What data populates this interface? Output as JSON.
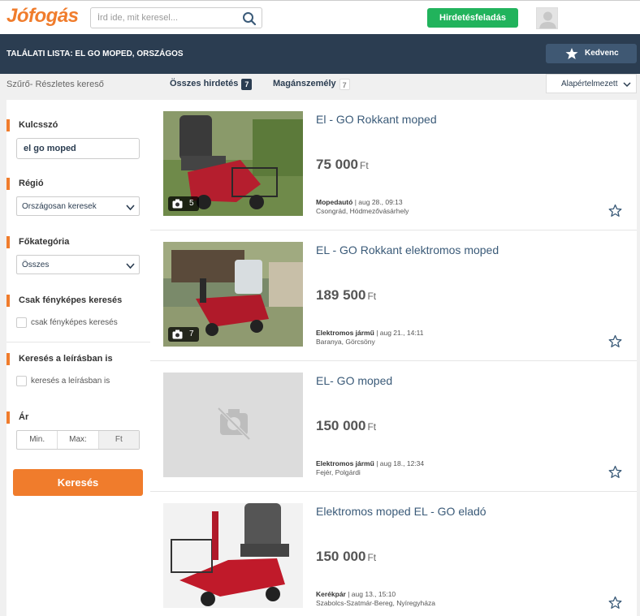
{
  "header": {
    "logo": "Jófogás",
    "search_placeholder": "Írd ide, mit keresel...",
    "post_button": "Hirdetésfeladás"
  },
  "bar": {
    "results_title": "TALÁLATI LISTA: EL GO MOPED, ORSZÁGOS",
    "favorite_button": "Kedvenc"
  },
  "tabs": {
    "filter_link": "Szűrő- Részletes kereső",
    "all_label": "Összes hirdetés",
    "all_count": "7",
    "private_label": "Magánszemély",
    "private_count": "7",
    "sort_value": "Alapértelmezett"
  },
  "sidebar": {
    "keyword_title": "Kulcsszó",
    "keyword_value": "el go moped",
    "region_title": "Régió",
    "region_value": "Országosan keresek",
    "category_title": "Főkategória",
    "category_value": "Összes",
    "photo_title": "Csak fényképes keresés",
    "photo_check_label": "csak fényképes keresés",
    "desc_title": "Keresés a leírásban is",
    "desc_check_label": "keresés a leírásban is",
    "price_title": "Ár",
    "price_min": "Min.",
    "price_max": "Max:",
    "price_currency": "Ft",
    "search_button": "Keresés"
  },
  "listings": [
    {
      "title": "El - GO Rokkant moped",
      "price": "75 000",
      "currency": "Ft",
      "category": "Mopedautó",
      "date": "| aug 28., 09:13",
      "location": "Csongrád, Hódmezővásárhely",
      "photos": "5"
    },
    {
      "title": "EL - GO Rokkant elektromos moped",
      "price": "189 500",
      "currency": "Ft",
      "category": "Elektromos jármű",
      "date": "| aug 21., 14:11",
      "location": "Baranya, Görcsöny",
      "photos": "7"
    },
    {
      "title": "EL- GO moped",
      "price": "150 000",
      "currency": "Ft",
      "category": "Elektromos jármű",
      "date": "| aug 18., 12:34",
      "location": "Fejér, Polgárdi",
      "photos": ""
    },
    {
      "title": "Elektromos moped EL - GO eladó",
      "price": "150 000",
      "currency": "Ft",
      "category": "Kerékpár",
      "date": "| aug 13., 15:10",
      "location": "Szabolcs-Szatmár-Bereg, Nyíregyháza",
      "photos": ""
    }
  ],
  "colors": {
    "brand_orange": "#f07c2c",
    "post_green": "#21b35c",
    "dark_bar": "#2b3d51",
    "title_link": "#3a5a78"
  }
}
